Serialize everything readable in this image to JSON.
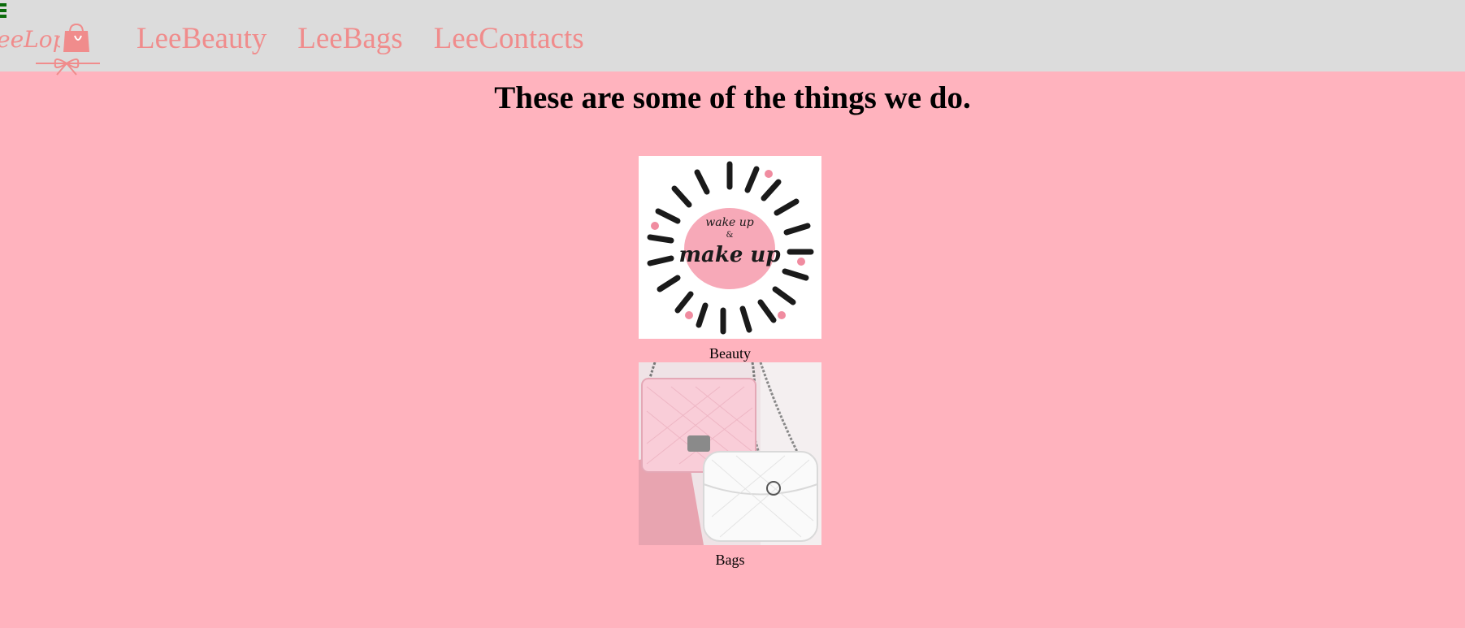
{
  "nav": {
    "logo_text": "eeLope",
    "links": [
      {
        "label": "LeeBeauty"
      },
      {
        "label": "LeeBags"
      },
      {
        "label": "LeeContacts"
      }
    ]
  },
  "main": {
    "headline": "These are some of the things we do.",
    "items": [
      {
        "caption": "Beauty",
        "image_text_top": "wake up",
        "image_text_mid": "&",
        "image_text_main": "make up"
      },
      {
        "caption": "Bags"
      }
    ]
  },
  "colors": {
    "navbar": "#dcdcdc",
    "page_background": "#ffb3be",
    "nav_link": "#f08c8c",
    "hamburger": "#0b6b0b"
  }
}
